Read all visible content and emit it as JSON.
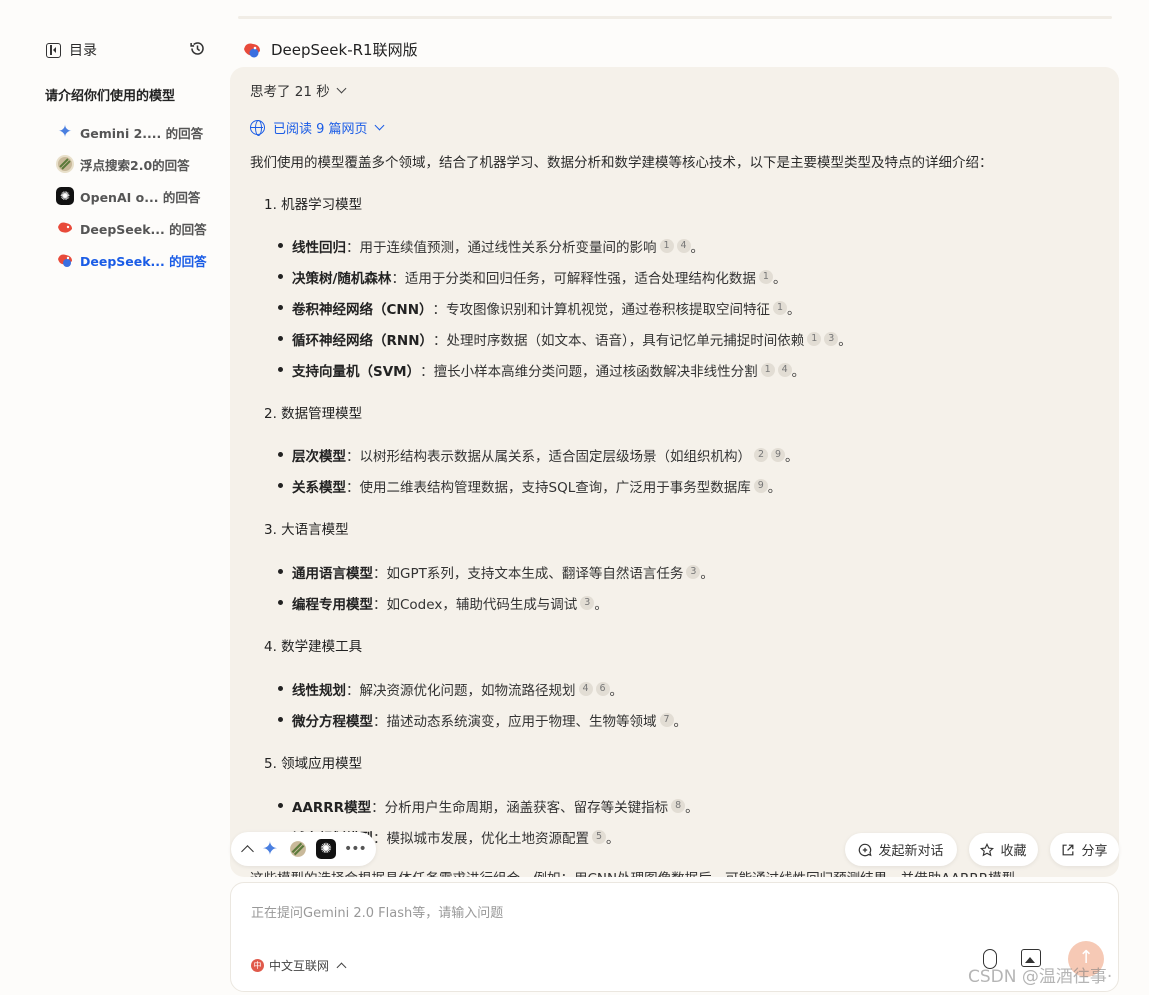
{
  "sidebar": {
    "toc_label": "目录",
    "question": "请介绍你们使用的模型",
    "items": [
      {
        "label": "Gemini 2....  的回答",
        "icon": "gemini-icon",
        "active": false
      },
      {
        "label": "浮点搜索2.0的回答",
        "icon": "float-search-icon",
        "active": false
      },
      {
        "label": "OpenAI o...  的回答",
        "icon": "openai-icon",
        "active": false
      },
      {
        "label": "DeepSeek...  的回答",
        "icon": "deepseek-icon",
        "active": false
      },
      {
        "label": "DeepSeek...  的回答",
        "icon": "deepseek-web-icon",
        "active": true
      }
    ]
  },
  "header": {
    "model_name": "DeepSeek-R1联网版"
  },
  "answer": {
    "thought": "思考了 21 秒",
    "read_pages": "已阅读 9 篇网页",
    "intro": "我们使用的模型覆盖多个领域，结合了机器学习、数据分析和数学建模等核心技术，以下是主要模型类型及特点的详细介绍：",
    "sections": [
      {
        "title": "1. 机器学习模型",
        "bullets": [
          {
            "term": "线性回归",
            "text": "：用于连续值预测，通过线性关系分析变量间的影响",
            "cites": [
              "1",
              "4"
            ],
            "end": "。"
          },
          {
            "term": "决策树/随机森林",
            "text": "：适用于分类和回归任务，可解释性强，适合处理结构化数据",
            "cites": [
              "1"
            ],
            "end": "。"
          },
          {
            "term": "卷积神经网络（CNN）",
            "text": "：专攻图像识别和计算机视觉，通过卷积核提取空间特征",
            "cites": [
              "1"
            ],
            "end": "。"
          },
          {
            "term": "循环神经网络（RNN）",
            "text": "：处理时序数据（如文本、语音），具有记忆单元捕捉时间依赖",
            "cites": [
              "1",
              "3"
            ],
            "end": "。"
          },
          {
            "term": "支持向量机（SVM）",
            "text": "：擅长小样本高维分类问题，通过核函数解决非线性分割",
            "cites": [
              "1",
              "4"
            ],
            "end": "。"
          }
        ]
      },
      {
        "title": "2. 数据管理模型",
        "bullets": [
          {
            "term": "层次模型",
            "text": "：以树形结构表示数据从属关系，适合固定层级场景（如组织机构）",
            "cites": [
              "2",
              "9"
            ],
            "end": "。"
          },
          {
            "term": "关系模型",
            "text": "：使用二维表结构管理数据，支持SQL查询，广泛用于事务型数据库",
            "cites": [
              "9"
            ],
            "end": "。"
          }
        ]
      },
      {
        "title": "3. 大语言模型",
        "bullets": [
          {
            "term": "通用语言模型",
            "text": "：如GPT系列，支持文本生成、翻译等自然语言任务",
            "cites": [
              "3"
            ],
            "end": "。"
          },
          {
            "term": "编程专用模型",
            "text": "：如Codex，辅助代码生成与调试",
            "cites": [
              "3"
            ],
            "end": "。"
          }
        ]
      },
      {
        "title": "4. 数学建模工具",
        "bullets": [
          {
            "term": "线性规划",
            "text": "：解决资源优化问题，如物流路径规划",
            "cites": [
              "4",
              "6"
            ],
            "end": "。"
          },
          {
            "term": "微分方程模型",
            "text": "：描述动态系统演变，应用于物理、生物等领域",
            "cites": [
              "7"
            ],
            "end": "。"
          }
        ]
      },
      {
        "title": "5. 领域应用模型",
        "bullets": [
          {
            "term": "AARRR模型",
            "text": "：分析用户生命周期，涵盖获客、留存等关键指标",
            "cites": [
              "8"
            ],
            "end": "。"
          },
          {
            "term": "城市规划模型",
            "text": "：模拟城市发展，优化土地资源配置",
            "cites": [
              "5"
            ],
            "end": "。"
          }
        ]
      }
    ],
    "partial_line": "这些模型的选择会根据具体任务需求进行组合，例如：用CNN处理图像数据后，可能通过线性回归预测结果，并借助AARRR模型"
  },
  "actions": {
    "new_chat": "发起新对话",
    "favorite": "收藏",
    "share": "分享"
  },
  "input": {
    "placeholder": "正在提问Gemini 2.0 Flash等，请输入问题",
    "network": "中文互联网"
  },
  "watermark": "CSDN @温酒往事·"
}
